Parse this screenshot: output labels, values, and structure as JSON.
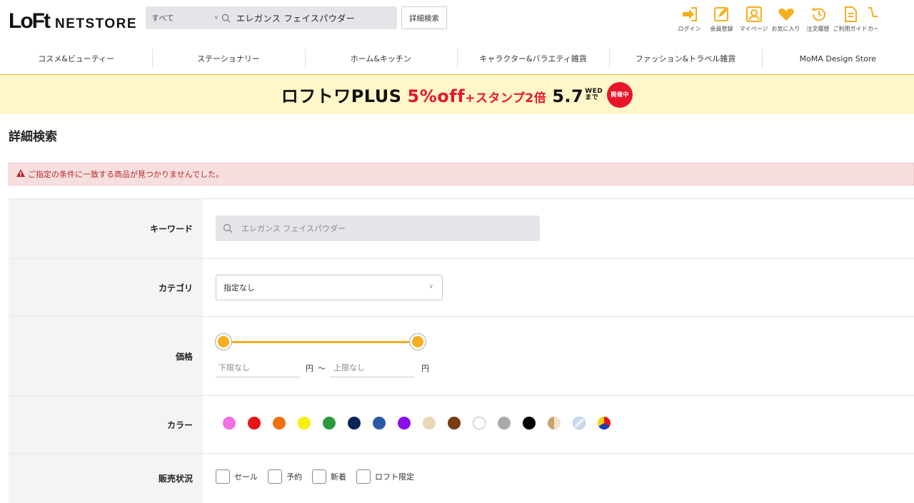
{
  "header": {
    "logo_main": "LoFt",
    "logo_sub": "NETSTORE",
    "search": {
      "category_value": "すべて",
      "query": "エレガンス フェイスパウダー"
    },
    "advanced_search_label": "詳細検索",
    "icon_nav": [
      {
        "label": "ログイン",
        "icon": "login-icon"
      },
      {
        "label": "会員登録",
        "icon": "register-icon"
      },
      {
        "label": "マイページ",
        "icon": "mypage-icon"
      },
      {
        "label": "お気に入り",
        "icon": "heart-icon"
      },
      {
        "label": "注文履歴",
        "icon": "history-icon"
      },
      {
        "label": "ご利用ガイド",
        "icon": "guide-icon"
      },
      {
        "label": "カー",
        "icon": "cart-icon"
      }
    ],
    "accent_color": "#f5ae1d"
  },
  "category_nav": [
    "コスメ&ビューティー",
    "ステーショナリー",
    "ホーム&キッチン",
    "キャラクター&バラエティ雑貨",
    "ファッション&トラベル雑貨",
    "MoMA Design Store"
  ],
  "banner": {
    "main": "ロフトワPLUS",
    "discount": "5%off",
    "plus": "+スタンプ2倍",
    "date": "5.7",
    "date_sub1": "WED",
    "date_sub2": "まで",
    "badge": "開催中",
    "bg_color": "#fff7c9",
    "red": "#e8162b"
  },
  "page": {
    "title": "詳細検索",
    "alert": "ご指定の条件に一致する商品が見つかりませんでした。"
  },
  "form": {
    "keyword": {
      "label": "キーワード",
      "value": "エレガンス フェイスパウダー"
    },
    "category": {
      "label": "カテゴリ",
      "value": "指定なし"
    },
    "price": {
      "label": "価格",
      "min_placeholder": "下限なし",
      "max_placeholder": "上限なし",
      "unit": "円",
      "separator": "〜"
    },
    "color": {
      "label": "カラー",
      "swatches": [
        "pink",
        "red",
        "orange",
        "yellow",
        "green",
        "navy",
        "blue",
        "purple",
        "beige",
        "brown",
        "white",
        "gray",
        "black",
        "gold",
        "silver",
        "multi"
      ]
    },
    "status": {
      "label": "販売状況",
      "options": [
        "セール",
        "予約",
        "新着",
        "ロフト限定"
      ]
    }
  }
}
